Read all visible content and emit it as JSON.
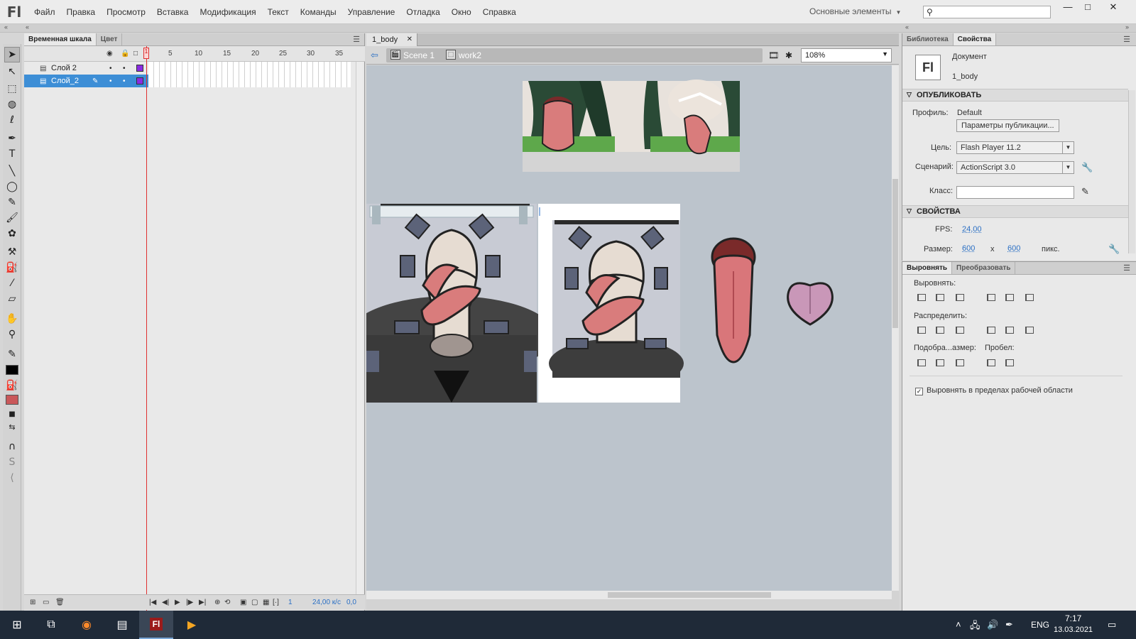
{
  "app": {
    "logo": "Fl",
    "menu": [
      "Файл",
      "Правка",
      "Просмотр",
      "Вставка",
      "Модификация",
      "Текст",
      "Команды",
      "Управление",
      "Отладка",
      "Окно",
      "Справка"
    ],
    "workspace": "Основные элементы",
    "search_placeholder": "",
    "window_buttons": {
      "minimize": "—",
      "maximize": "□",
      "close": "✕"
    }
  },
  "timeline": {
    "tabs": [
      "Временная шкала",
      "Цвет"
    ],
    "frame_numbers": [
      "1",
      "5",
      "10",
      "15",
      "20",
      "25",
      "30",
      "35"
    ],
    "layers": [
      {
        "name": "Слой 2",
        "selected": false
      },
      {
        "name": "Слой_2",
        "selected": true
      }
    ],
    "footer": {
      "current_frame": "1",
      "fps": "24,00 к/с",
      "time": "0,0"
    }
  },
  "document": {
    "tab": "1_body",
    "tab_close": "✕",
    "breadcrumb": [
      "Scene 1",
      "work2"
    ],
    "zoom": "108%"
  },
  "properties": {
    "tabs": [
      "Библиотека",
      "Свойства"
    ],
    "doc_icon": "Fl",
    "doc_type": "Документ",
    "doc_name": "1_body",
    "publish_section": "ОПУБЛИКОВАТЬ",
    "profile_label": "Профиль:",
    "profile_value": "Default",
    "publish_settings_button": "Параметры публикации...",
    "target_label": "Цель:",
    "target_value": "Flash Player 11.2",
    "script_label": "Сценарий:",
    "script_value": "ActionScript 3.0",
    "class_label": "Класс:",
    "class_value": "",
    "props_section": "СВОЙСТВА",
    "fps_label": "FPS:",
    "fps_value": "24,00",
    "size_label": "Размер:",
    "width": "600",
    "x_sep": "x",
    "height": "600",
    "unit": "пикс."
  },
  "align": {
    "tabs": [
      "Выровнять",
      "Преобразовать"
    ],
    "align_label": "Выровнять:",
    "distribute_label": "Распределить:",
    "match_label": "Подобра...азмер:",
    "space_label": "Пробел:",
    "to_stage_label": "Выровнять в пределах рабочей области",
    "to_stage_checked": "✓"
  },
  "taskbar": {
    "language": "ENG",
    "time": "7:17",
    "date": "13.03.2021"
  }
}
